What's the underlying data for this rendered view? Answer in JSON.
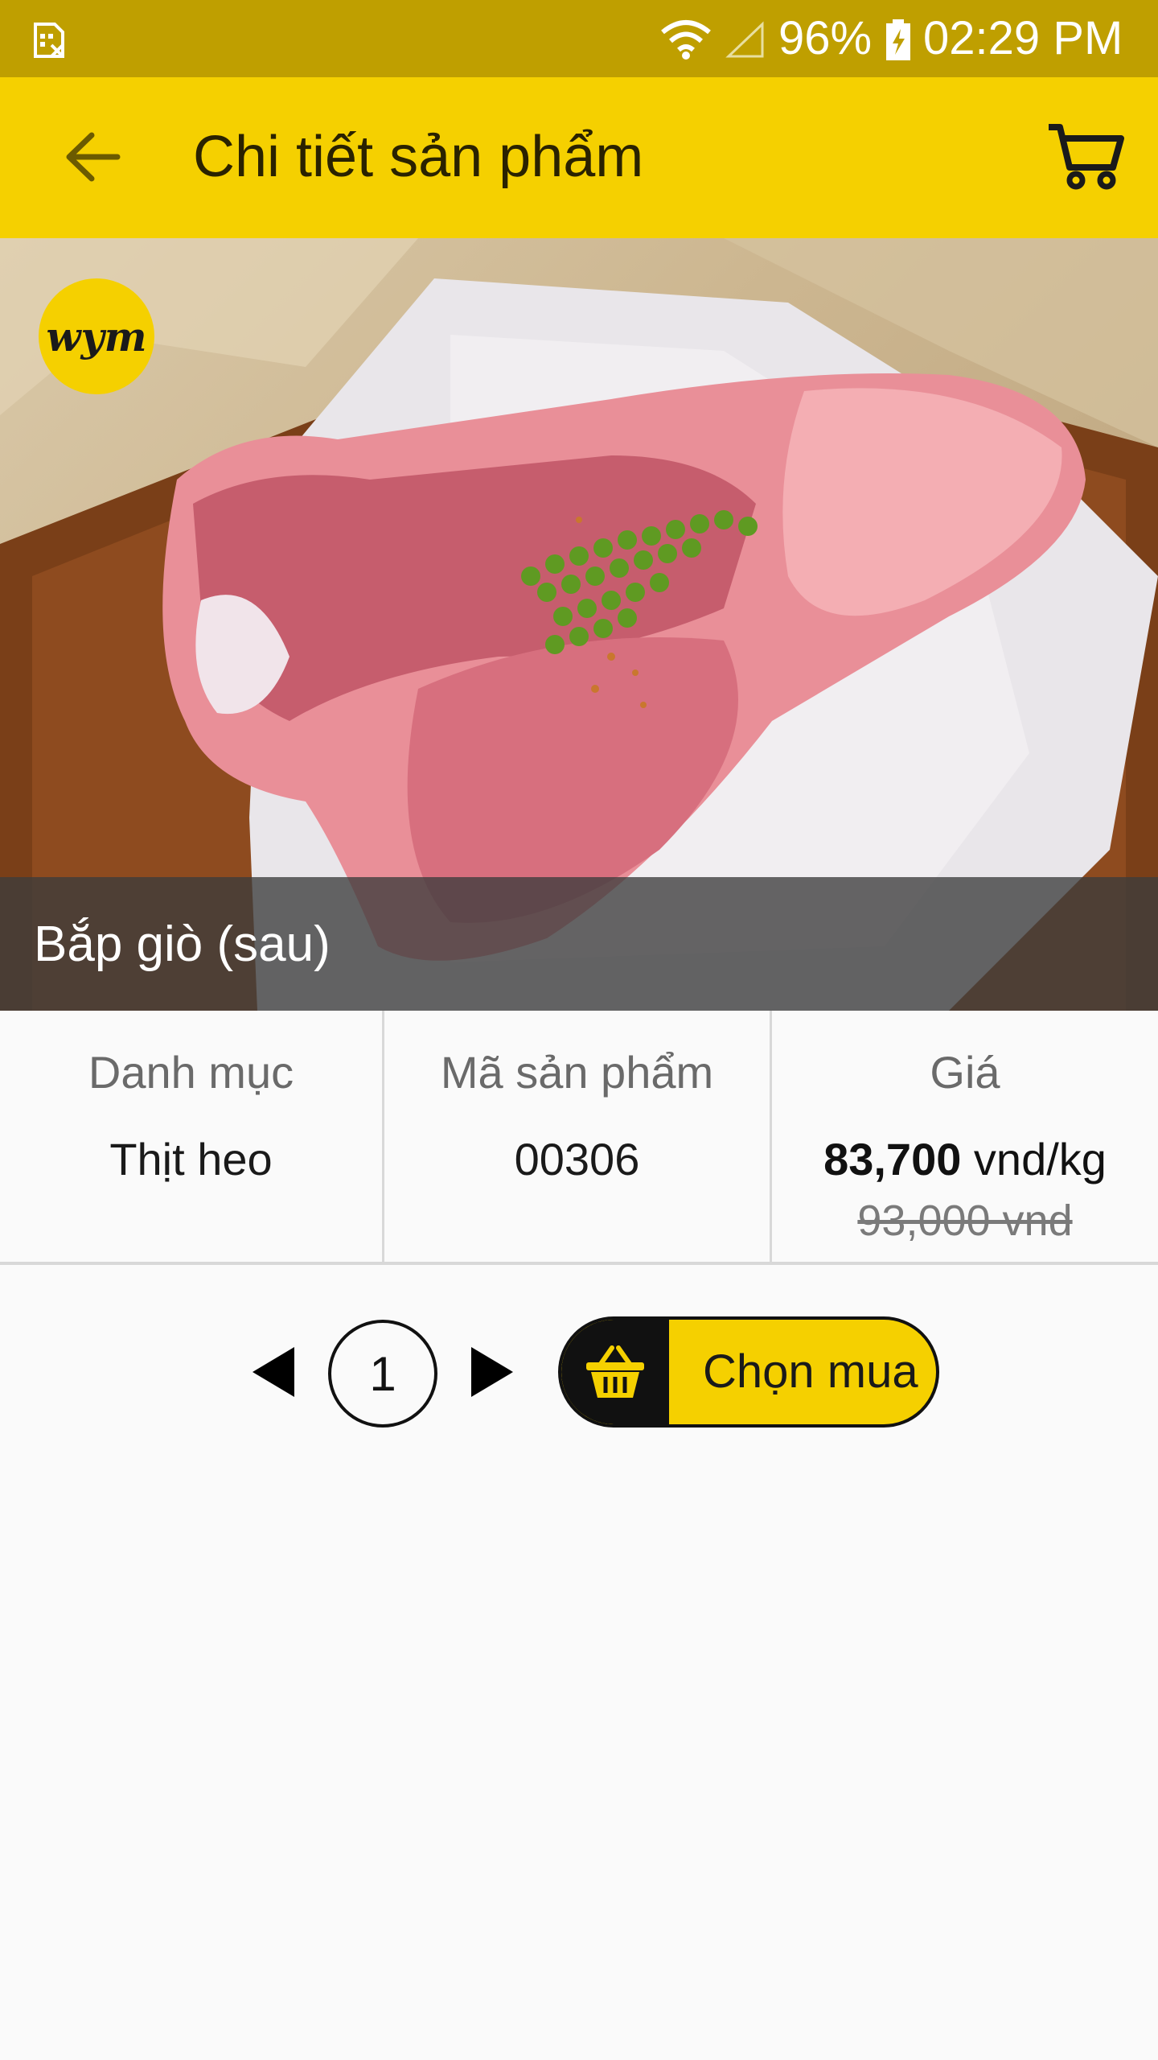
{
  "status_bar": {
    "battery_percent": "96%",
    "time": "02:29 PM"
  },
  "app_bar": {
    "title": "Chi tiết sản phẩm"
  },
  "product": {
    "name": "Bắp giò (sau)",
    "brand_logo_text": "wym"
  },
  "info": {
    "category_label": "Danh mục",
    "category_value": "Thịt heo",
    "code_label": "Mã sản phẩm",
    "code_value": "00306",
    "price_label": "Giá",
    "price_amount": "83,700",
    "price_unit": " vnd/kg",
    "old_price": "93,000 vnd"
  },
  "quantity": {
    "value": "1"
  },
  "buy_button": {
    "label": "Chọn mua"
  },
  "colors": {
    "status_bar": "#bf9f00",
    "accent": "#f5d000",
    "text_dark": "#1a1a1a"
  },
  "icons": [
    "sim-icon",
    "wifi-icon",
    "signal-icon",
    "battery-charging-icon",
    "back-arrow-icon",
    "cart-icon",
    "prev-arrow-icon",
    "next-arrow-icon",
    "basket-icon"
  ]
}
